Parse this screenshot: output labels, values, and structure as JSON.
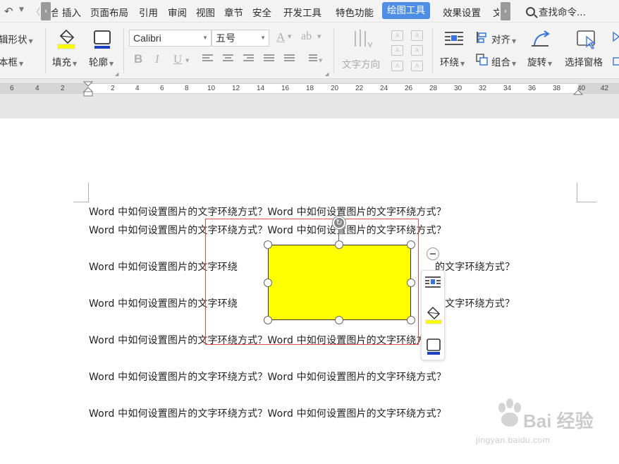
{
  "menubar": {
    "undo_icon": "undo-icon",
    "items": [
      {
        "label": "插入"
      },
      {
        "label": "页面布局"
      },
      {
        "label": "引用"
      },
      {
        "label": "审阅"
      },
      {
        "label": "视图"
      },
      {
        "label": "章节"
      },
      {
        "label": "安全"
      },
      {
        "label": "开发工具"
      },
      {
        "label": "特色功能"
      },
      {
        "label": "绘图工具"
      },
      {
        "label": "效果设置"
      }
    ],
    "active_tab": "绘图工具",
    "clipped_left": "合",
    "clipped_right": "文",
    "search": "查找命令...",
    "accent_color": "#4e8ee6"
  },
  "ribbon": {
    "edit_shape": "辑形状",
    "text_box": "本框",
    "fill": "填充",
    "outline": "轮廓",
    "font_name": "Calibri",
    "font_size": "五号",
    "text_direction": "文字方向",
    "wrap": "环绕",
    "align": "对齐",
    "group": "组合",
    "rotate": "旋转",
    "selection_pane": "选择窗格",
    "fill_color": "#ffff00",
    "outline_color": "#1a3fbf"
  },
  "ruler": {
    "labels": [
      "6",
      "4",
      "2",
      "2",
      "4",
      "6",
      "8",
      "10",
      "12",
      "14",
      "16",
      "18",
      "20",
      "22",
      "24",
      "26",
      "28",
      "30",
      "32",
      "34",
      "36",
      "38",
      "40",
      "42"
    ]
  },
  "document": {
    "line_text": "Word 中如何设置图片的文字环绕方式？Word 中如何设置图片的文字环绕方式？",
    "left_fragment": "Word 中如何设置图片的文字环绕",
    "right_fragment": "的文字环绕方式？",
    "right_fragment_2": "的文字环绕方式？",
    "right_fragment_3": "的文字环绕方式？"
  },
  "shape": {
    "fill_color": "#ffff00",
    "selection_color": "#e05050"
  },
  "watermark": {
    "brand": "Bai 经验",
    "url": "jingyan.baidu.com"
  }
}
